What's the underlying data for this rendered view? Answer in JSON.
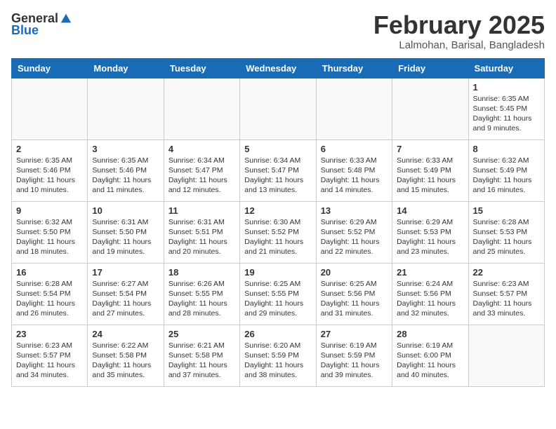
{
  "header": {
    "logo_general": "General",
    "logo_blue": "Blue",
    "month_title": "February 2025",
    "location": "Lalmohan, Barisal, Bangladesh"
  },
  "weekdays": [
    "Sunday",
    "Monday",
    "Tuesday",
    "Wednesday",
    "Thursday",
    "Friday",
    "Saturday"
  ],
  "weeks": [
    [
      {
        "day": "",
        "info": ""
      },
      {
        "day": "",
        "info": ""
      },
      {
        "day": "",
        "info": ""
      },
      {
        "day": "",
        "info": ""
      },
      {
        "day": "",
        "info": ""
      },
      {
        "day": "",
        "info": ""
      },
      {
        "day": "1",
        "info": "Sunrise: 6:35 AM\nSunset: 5:45 PM\nDaylight: 11 hours\nand 9 minutes."
      }
    ],
    [
      {
        "day": "2",
        "info": "Sunrise: 6:35 AM\nSunset: 5:46 PM\nDaylight: 11 hours\nand 10 minutes."
      },
      {
        "day": "3",
        "info": "Sunrise: 6:35 AM\nSunset: 5:46 PM\nDaylight: 11 hours\nand 11 minutes."
      },
      {
        "day": "4",
        "info": "Sunrise: 6:34 AM\nSunset: 5:47 PM\nDaylight: 11 hours\nand 12 minutes."
      },
      {
        "day": "5",
        "info": "Sunrise: 6:34 AM\nSunset: 5:47 PM\nDaylight: 11 hours\nand 13 minutes."
      },
      {
        "day": "6",
        "info": "Sunrise: 6:33 AM\nSunset: 5:48 PM\nDaylight: 11 hours\nand 14 minutes."
      },
      {
        "day": "7",
        "info": "Sunrise: 6:33 AM\nSunset: 5:49 PM\nDaylight: 11 hours\nand 15 minutes."
      },
      {
        "day": "8",
        "info": "Sunrise: 6:32 AM\nSunset: 5:49 PM\nDaylight: 11 hours\nand 16 minutes."
      }
    ],
    [
      {
        "day": "9",
        "info": "Sunrise: 6:32 AM\nSunset: 5:50 PM\nDaylight: 11 hours\nand 18 minutes."
      },
      {
        "day": "10",
        "info": "Sunrise: 6:31 AM\nSunset: 5:50 PM\nDaylight: 11 hours\nand 19 minutes."
      },
      {
        "day": "11",
        "info": "Sunrise: 6:31 AM\nSunset: 5:51 PM\nDaylight: 11 hours\nand 20 minutes."
      },
      {
        "day": "12",
        "info": "Sunrise: 6:30 AM\nSunset: 5:52 PM\nDaylight: 11 hours\nand 21 minutes."
      },
      {
        "day": "13",
        "info": "Sunrise: 6:29 AM\nSunset: 5:52 PM\nDaylight: 11 hours\nand 22 minutes."
      },
      {
        "day": "14",
        "info": "Sunrise: 6:29 AM\nSunset: 5:53 PM\nDaylight: 11 hours\nand 23 minutes."
      },
      {
        "day": "15",
        "info": "Sunrise: 6:28 AM\nSunset: 5:53 PM\nDaylight: 11 hours\nand 25 minutes."
      }
    ],
    [
      {
        "day": "16",
        "info": "Sunrise: 6:28 AM\nSunset: 5:54 PM\nDaylight: 11 hours\nand 26 minutes."
      },
      {
        "day": "17",
        "info": "Sunrise: 6:27 AM\nSunset: 5:54 PM\nDaylight: 11 hours\nand 27 minutes."
      },
      {
        "day": "18",
        "info": "Sunrise: 6:26 AM\nSunset: 5:55 PM\nDaylight: 11 hours\nand 28 minutes."
      },
      {
        "day": "19",
        "info": "Sunrise: 6:25 AM\nSunset: 5:55 PM\nDaylight: 11 hours\nand 29 minutes."
      },
      {
        "day": "20",
        "info": "Sunrise: 6:25 AM\nSunset: 5:56 PM\nDaylight: 11 hours\nand 31 minutes."
      },
      {
        "day": "21",
        "info": "Sunrise: 6:24 AM\nSunset: 5:56 PM\nDaylight: 11 hours\nand 32 minutes."
      },
      {
        "day": "22",
        "info": "Sunrise: 6:23 AM\nSunset: 5:57 PM\nDaylight: 11 hours\nand 33 minutes."
      }
    ],
    [
      {
        "day": "23",
        "info": "Sunrise: 6:23 AM\nSunset: 5:57 PM\nDaylight: 11 hours\nand 34 minutes."
      },
      {
        "day": "24",
        "info": "Sunrise: 6:22 AM\nSunset: 5:58 PM\nDaylight: 11 hours\nand 35 minutes."
      },
      {
        "day": "25",
        "info": "Sunrise: 6:21 AM\nSunset: 5:58 PM\nDaylight: 11 hours\nand 37 minutes."
      },
      {
        "day": "26",
        "info": "Sunrise: 6:20 AM\nSunset: 5:59 PM\nDaylight: 11 hours\nand 38 minutes."
      },
      {
        "day": "27",
        "info": "Sunrise: 6:19 AM\nSunset: 5:59 PM\nDaylight: 11 hours\nand 39 minutes."
      },
      {
        "day": "28",
        "info": "Sunrise: 6:19 AM\nSunset: 6:00 PM\nDaylight: 11 hours\nand 40 minutes."
      },
      {
        "day": "",
        "info": ""
      }
    ]
  ]
}
